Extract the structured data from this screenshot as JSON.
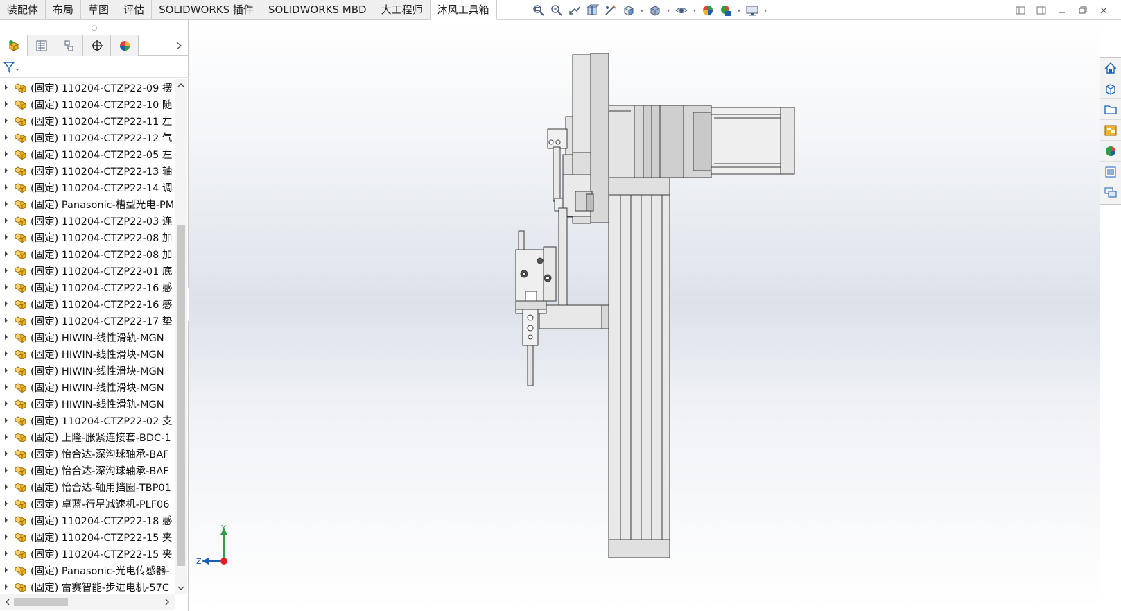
{
  "tabs": [
    {
      "label": "装配体",
      "active": false
    },
    {
      "label": "布局",
      "active": false
    },
    {
      "label": "草图",
      "active": false
    },
    {
      "label": "评估",
      "active": false
    },
    {
      "label": "SOLIDWORKS 插件",
      "active": false
    },
    {
      "label": "SOLIDWORKS MBD",
      "active": false
    },
    {
      "label": "大工程师",
      "active": false
    },
    {
      "label": "沐风工具箱",
      "active": true
    }
  ],
  "view_toolbar": [
    "zoom-to-fit-icon",
    "zoom-to-area-icon",
    "previous-view-icon",
    "section-view-icon",
    "dynamic-annotation-icon",
    "view-orientation-icon",
    "display-style-icon",
    "hide-show-icon",
    "edit-appearance-icon",
    "apply-scene-icon",
    "view-settings-icon"
  ],
  "feature_manager": {
    "tabs": [
      "featuremanager-tree-icon",
      "propertymanager-icon",
      "configurationmanager-icon",
      "dimxpertmanager-icon",
      "displaymanager-icon"
    ],
    "items": [
      "(固定) 110204-CTZP22-09 摆",
      "(固定) 110204-CTZP22-10 随",
      "(固定) 110204-CTZP22-11 左",
      "(固定) 110204-CTZP22-12 气",
      "(固定) 110204-CTZP22-05 左",
      "(固定) 110204-CTZP22-13 轴",
      "(固定) 110204-CTZP22-14 调",
      "(固定) Panasonic-槽型光电-PM",
      "(固定) 110204-CTZP22-03 连",
      "(固定) 110204-CTZP22-08 加",
      "(固定) 110204-CTZP22-08 加",
      "(固定) 110204-CTZP22-01 底",
      "(固定) 110204-CTZP22-16 感",
      "(固定) 110204-CTZP22-16 感",
      "(固定) 110204-CTZP22-17 垫",
      "(固定) HIWIN-线性滑轨-MGN",
      "(固定) HIWIN-线性滑块-MGN",
      "(固定) HIWIN-线性滑块-MGN",
      "(固定) HIWIN-线性滑块-MGN",
      "(固定) HIWIN-线性滑轨-MGN",
      "(固定) 110204-CTZP22-02 支",
      "(固定) 上隆-胀紧连接套-BDC-1",
      "(固定) 怡合达-深沟球轴承-BAF",
      "(固定) 怡合达-深沟球轴承-BAF",
      "(固定) 怡合达-轴用挡圈-TBP01",
      "(固定) 卓蓝-行星减速机-PLF06",
      "(固定) 110204-CTZP22-18 感",
      "(固定) 110204-CTZP22-15 夹",
      "(固定) 110204-CTZP22-15 夹",
      "(固定) Panasonic-光电传感器-",
      "(固定) 雷赛智能-步进电机-57C"
    ]
  },
  "task_pane": [
    "solidworks-resources-icon",
    "design-library-icon",
    "file-explorer-icon",
    "view-palette-icon",
    "appearances-scenes-icon",
    "custom-properties-icon",
    "forum-icon"
  ],
  "triad": {
    "y_label": "Y",
    "z_label": "Z"
  },
  "colors": {
    "accent": "#1a5fb4",
    "icon_yellow": "#f0b429"
  }
}
